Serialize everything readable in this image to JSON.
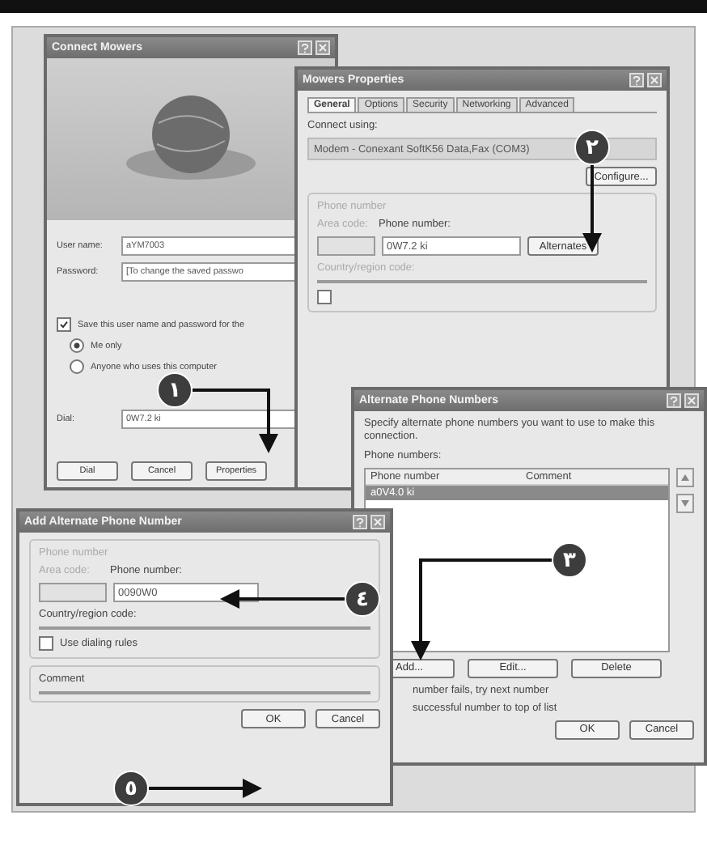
{
  "connect_dialog": {
    "title": "Connect Mowers",
    "fields": [
      {
        "label": "User name:",
        "value": "aYM7003"
      },
      {
        "label": "Password:",
        "value": "[To change the saved passwo"
      }
    ],
    "save_checkbox": {
      "label": "Save this user name and password for the",
      "checked": true
    },
    "radios": [
      {
        "label": "Me only",
        "selected": true
      },
      {
        "label": "Anyone who uses this computer",
        "selected": false
      }
    ],
    "dial": {
      "label": "Dial:",
      "value": "0W7.2 ki"
    },
    "buttons": [
      "Dial",
      "Cancel",
      "Properties"
    ]
  },
  "properties_dialog": {
    "title": "Mowers Properties",
    "tabs": [
      {
        "label": "General",
        "selected": true
      },
      {
        "label": "Options",
        "selected": false
      },
      {
        "label": "Security",
        "selected": false
      },
      {
        "label": "Networking",
        "selected": false
      },
      {
        "label": "Advanced",
        "selected": false
      }
    ],
    "connect_using": "Connect using:",
    "device": "Modem - Conexant SoftK56 Data,Fax (COM3)",
    "configure_button": "Configure...",
    "group": "Phone number",
    "area_code": "Area code:",
    "phone_label": "Phone number:",
    "phone_value": "0W7.2 ki",
    "alternates_button": "Alternates",
    "country_label": "Country/region code:",
    "dialing_rules_checked": false
  },
  "alternates_dialog": {
    "title": "Alternate Phone Numbers",
    "intro": "Specify alternate phone numbers you want to use to make this connection.",
    "list_label": "Phone numbers:",
    "columns": [
      "Phone number",
      "Comment"
    ],
    "rows": [
      {
        "number": "a0V4.0 ki",
        "selected": true
      }
    ],
    "buttons": [
      "Add...",
      "Edit...",
      "Delete"
    ],
    "options": [
      {
        "label": "number fails, try next number"
      },
      {
        "label": "successful number to top of list"
      }
    ],
    "footer_buttons": [
      "OK",
      "Cancel"
    ]
  },
  "add_dialog": {
    "title": "Add Alternate Phone Number",
    "group": "Phone number",
    "area_code": "Area code:",
    "phone_label": "Phone number:",
    "phone_value": "0090W0",
    "country_label": "Country/region code:",
    "dialing_rules": {
      "label": "Use dialing rules",
      "checked": false
    },
    "comment_label": "Comment",
    "footer_buttons": [
      "OK",
      "Cancel"
    ]
  },
  "callouts": [
    {
      "label": "١"
    },
    {
      "label": "٢"
    },
    {
      "label": "٣"
    },
    {
      "label": "٤"
    },
    {
      "label": "٥"
    }
  ]
}
